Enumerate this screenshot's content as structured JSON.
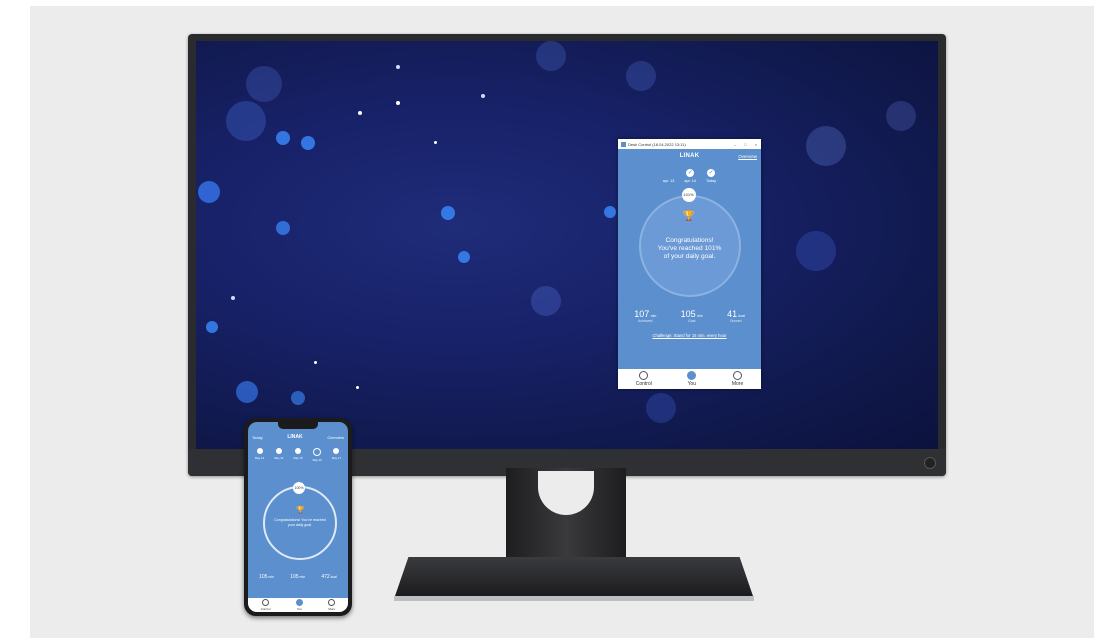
{
  "desk_app": {
    "window_title": "Desk Control (18.04.2022 13:11)",
    "brand": "LINAK",
    "overview_link": "Overview",
    "days": [
      {
        "label": "apr. 13",
        "checked": false
      },
      {
        "label": "apr. 14",
        "checked": true
      },
      {
        "label": "Today",
        "checked": true
      }
    ],
    "percent_badge": "101%",
    "congrats_line1": "Congratulations!",
    "congrats_line2": "You've reached 101%",
    "congrats_line3": "of your daily goal.",
    "stats": [
      {
        "value": "107",
        "unit": "min",
        "label": "Achieved"
      },
      {
        "value": "105",
        "unit": "min",
        "label": "Goal"
      },
      {
        "value": "41",
        "unit": "kcal",
        "label": "Burned"
      }
    ],
    "challenge_link": "Challenge: Stand for 15 min. every hour",
    "tabs": [
      {
        "label": "Control",
        "icon": "control-icon",
        "active": false
      },
      {
        "label": "You",
        "icon": "you-icon",
        "active": true
      },
      {
        "label": "More",
        "icon": "more-icon",
        "active": false
      }
    ]
  },
  "phone_app": {
    "header_left": "Today",
    "brand": "LINAK",
    "header_right": "Overview",
    "days": [
      {
        "label": "May 13",
        "done": true
      },
      {
        "label": "May 14",
        "done": true
      },
      {
        "label": "May 15",
        "done": true
      },
      {
        "label": "May 16",
        "done": false
      },
      {
        "label": "May 17",
        "done": true
      }
    ],
    "percent_badge": "100%",
    "message": "Congratulations! You've reached your daily goal.",
    "stats": [
      {
        "value": "105",
        "unit": "min"
      },
      {
        "value": "105",
        "unit": "min"
      },
      {
        "value": "472",
        "unit": "kcal"
      }
    ],
    "tabs": [
      {
        "label": "Control"
      },
      {
        "label": "You"
      },
      {
        "label": "More"
      }
    ]
  },
  "colors": {
    "app_blue": "#5b8fcd",
    "wallpaper": "#18226a",
    "background": "#ececec"
  }
}
